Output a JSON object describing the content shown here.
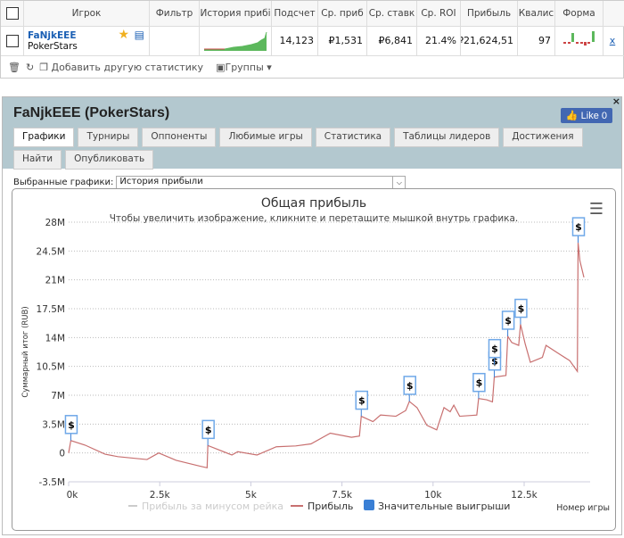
{
  "table": {
    "headers": [
      "Игрок",
      "Фильтр",
      "История прибі",
      "Подсчет",
      "Ср. приб",
      "Ср. ставк",
      "Ср. ROI",
      "Прибыль",
      "Квалис",
      "Форма"
    ],
    "row": {
      "player": "FaNjkEEE",
      "site": "PokerStars",
      "count": "14,123",
      "avg_profit": "₽1,531",
      "avg_stake": "₽6,841",
      "roi": "21.4%",
      "profit": "₽21,624,51",
      "quality": "97",
      "remove": "x"
    },
    "footer": {
      "add_stat": "Добавить другую статистику",
      "groups": "Группы"
    }
  },
  "panel": {
    "title": "FaNjkEEE (PokerStars)",
    "like": "Like 0",
    "close": "×",
    "tabs": [
      "Графики",
      "Турниры",
      "Оппоненты",
      "Любимые игры",
      "Статистика",
      "Таблицы лидеров",
      "Достижения",
      "Найти",
      "Опубликовать"
    ],
    "selected_label": "Выбранные графики:",
    "selected_value": "История прибыли"
  },
  "chart_data": {
    "type": "line",
    "title": "Общая прибыль",
    "subtitle": "Чтобы увеличить изображение, кликните и перетащите мышкой внутрь графика.",
    "xlabel": "Номер игры",
    "ylabel": "Суммарный итог (RUB)",
    "xlim": [
      0,
      14200
    ],
    "ylim": [
      -3.5,
      28
    ],
    "xticks": [
      "0k",
      "2.5k",
      "5k",
      "7.5k",
      "10k",
      "12.5k"
    ],
    "yticks": [
      "28M",
      "24.5M",
      "21M",
      "17.5M",
      "14M",
      "10.5M",
      "7M",
      "3.5M",
      "0",
      "-3.5M"
    ],
    "grid": true,
    "legend": "bottom",
    "legend_entries": [
      "Прибыль за минусом рейка",
      "Прибыль",
      "Значительные выигрыши"
    ],
    "colors": {
      "profit": "#c87070",
      "rake": "#cccccc",
      "wins": "#3a7fd5"
    },
    "series": [
      {
        "name": "Прибыль",
        "unit": "M RUB",
        "points": [
          [
            0,
            0
          ],
          [
            60,
            1.5
          ],
          [
            450,
            0.95
          ],
          [
            1000,
            -0.15
          ],
          [
            1350,
            -0.45
          ],
          [
            2150,
            -0.8
          ],
          [
            2470,
            0
          ],
          [
            2950,
            -0.9
          ],
          [
            3600,
            -1.6
          ],
          [
            3800,
            -1.8
          ],
          [
            3820,
            0.9
          ],
          [
            4480,
            -0.25
          ],
          [
            4640,
            0.15
          ],
          [
            5170,
            -0.25
          ],
          [
            5700,
            0.75
          ],
          [
            6230,
            0.85
          ],
          [
            6650,
            1.1
          ],
          [
            7180,
            2.4
          ],
          [
            7760,
            1.9
          ],
          [
            7980,
            2.05
          ],
          [
            8030,
            4.45
          ],
          [
            8350,
            3.8
          ],
          [
            8560,
            4.6
          ],
          [
            8980,
            4.45
          ],
          [
            9250,
            5.15
          ],
          [
            9350,
            6.25
          ],
          [
            9560,
            5.5
          ],
          [
            9830,
            3.35
          ],
          [
            10100,
            2.8
          ],
          [
            10300,
            5.5
          ],
          [
            10470,
            5
          ],
          [
            10570,
            5.8
          ],
          [
            10730,
            4.45
          ],
          [
            11200,
            4.6
          ],
          [
            11250,
            6.6
          ],
          [
            11470,
            6.45
          ],
          [
            11630,
            6.2
          ],
          [
            11680,
            9.2
          ],
          [
            12000,
            9.4
          ],
          [
            12050,
            14.15
          ],
          [
            12160,
            13.4
          ],
          [
            12350,
            13.05
          ],
          [
            12400,
            15.6
          ],
          [
            12530,
            13.2
          ],
          [
            12670,
            11
          ],
          [
            13000,
            11.6
          ],
          [
            13100,
            13.05
          ],
          [
            13430,
            12.1
          ],
          [
            13750,
            11.2
          ],
          [
            13960,
            9.9
          ],
          [
            13980,
            25.5
          ],
          [
            14030,
            23.3
          ],
          [
            14140,
            21.3
          ]
        ]
      }
    ],
    "significant_wins": [
      [
        60,
        1.5
      ],
      [
        3820,
        0.9
      ],
      [
        8030,
        4.45
      ],
      [
        9350,
        6.25
      ],
      [
        11250,
        6.6
      ],
      [
        11680,
        9.2
      ],
      [
        11680,
        9.2
      ],
      [
        12050,
        14.15
      ],
      [
        12400,
        15.6
      ],
      [
        13980,
        25.5
      ]
    ],
    "marker_label": "$"
  }
}
